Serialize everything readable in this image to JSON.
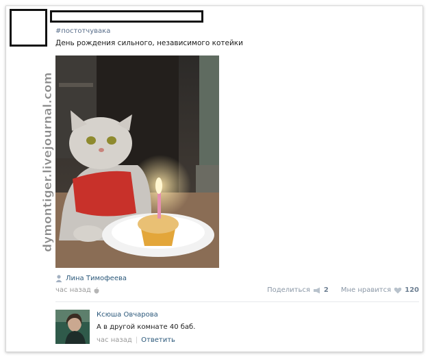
{
  "post": {
    "hashtag": "#постотчувака",
    "text": "День рождения сильного, независимого котейки",
    "author_name": "Лина Тимофеева",
    "time": "час назад",
    "share_label": "Поделиться",
    "share_count": "2",
    "like_label": "Мне нравится",
    "like_count": "120"
  },
  "watermark": {
    "text": "dymontiger.livejournal.com"
  },
  "comment": {
    "author": "Ксюша Овчарова",
    "text": "А в другой комнате 40 баб.",
    "time": "час назад",
    "reply_label": "Ответить",
    "separator": "|"
  },
  "colors": {
    "link": "#2b587a",
    "muted": "#999999",
    "action": "#8a97a6"
  }
}
